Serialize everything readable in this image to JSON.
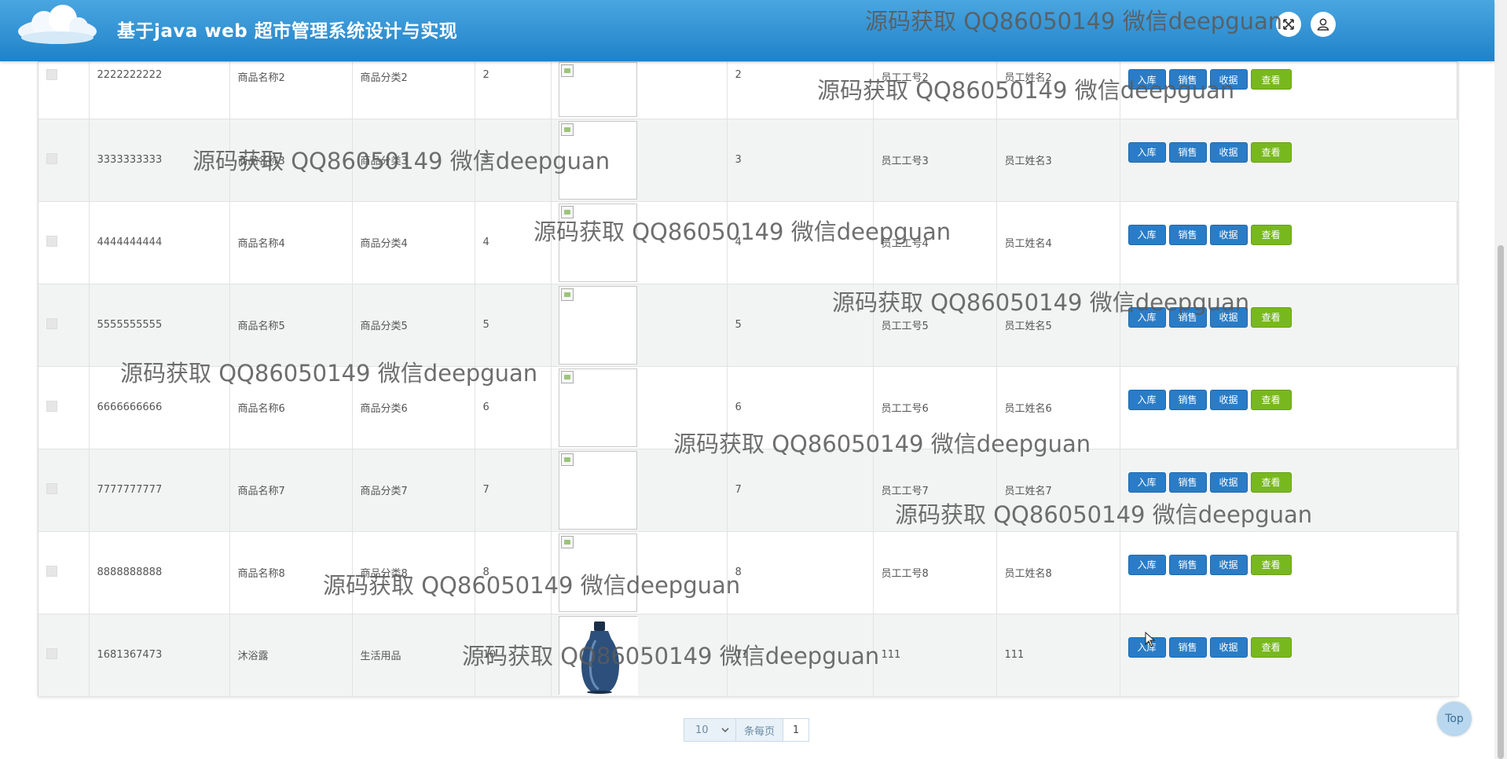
{
  "header": {
    "title": "基于java web 超市管理系统设计与实现",
    "fullscreen_icon": "fullscreen-icon",
    "user_icon": "user-icon"
  },
  "table": {
    "action_labels": {
      "stock_in": "入库",
      "sell": "销售",
      "receipt": "收据",
      "view": "查看"
    },
    "rows": [
      {
        "code": "2222222222",
        "name": "商品名称2",
        "category": "商品分类2",
        "qty": "2",
        "image": "broken",
        "value": "2",
        "emp_no": "员工工号2",
        "emp_name": "员工姓名2"
      },
      {
        "code": "3333333333",
        "name": "商品名称3",
        "category": "商品分类3",
        "qty": "3",
        "image": "broken",
        "value": "3",
        "emp_no": "员工工号3",
        "emp_name": "员工姓名3"
      },
      {
        "code": "4444444444",
        "name": "商品名称4",
        "category": "商品分类4",
        "qty": "4",
        "image": "broken",
        "value": "4",
        "emp_no": "员工工号4",
        "emp_name": "员工姓名4"
      },
      {
        "code": "5555555555",
        "name": "商品名称5",
        "category": "商品分类5",
        "qty": "5",
        "image": "broken",
        "value": "5",
        "emp_no": "员工工号5",
        "emp_name": "员工姓名5"
      },
      {
        "code": "6666666666",
        "name": "商品名称6",
        "category": "商品分类6",
        "qty": "6",
        "image": "broken",
        "value": "6",
        "emp_no": "员工工号6",
        "emp_name": "员工姓名6"
      },
      {
        "code": "7777777777",
        "name": "商品名称7",
        "category": "商品分类7",
        "qty": "7",
        "image": "broken",
        "value": "7",
        "emp_no": "员工工号7",
        "emp_name": "员工姓名7"
      },
      {
        "code": "8888888888",
        "name": "商品名称8",
        "category": "商品分类8",
        "qty": "8",
        "image": "broken",
        "value": "8",
        "emp_no": "员工工号8",
        "emp_name": "员工姓名8"
      },
      {
        "code": "1681367473",
        "name": "沐浴露",
        "category": "生活用品",
        "qty": "10",
        "image": "bottle",
        "value": "11",
        "emp_no": "111",
        "emp_name": "111"
      }
    ]
  },
  "pagination": {
    "page_size": "10",
    "per_page_label": "条每页",
    "current_page": "1"
  },
  "top_button": "Top",
  "watermark": "源码获取 QQ86050149 微信deepguan"
}
